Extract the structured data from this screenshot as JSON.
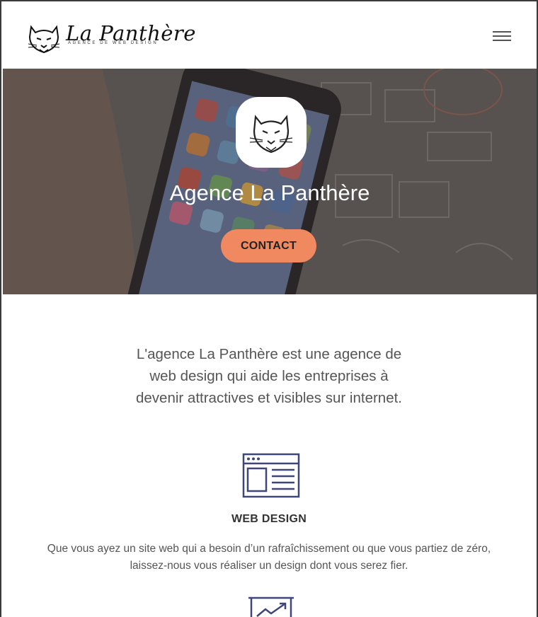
{
  "header": {
    "logo_title": "La Panthère",
    "logo_subtitle": "AGENCE DE WEB DESIGN",
    "menu_icon": "hamburger-menu-icon"
  },
  "hero": {
    "title": "Agence La Panthère",
    "contact_label": "CONTACT",
    "badge_icon": "panther-head-icon",
    "accent_color": "#f0895f"
  },
  "intro": {
    "line1": "L'agence La Panthère est une agence de",
    "line2": "web design qui aide les entreprises à",
    "line3": "devenir attractives et visibles sur internet."
  },
  "services": [
    {
      "icon": "web-page-layout-icon",
      "title": "WEB DESIGN",
      "desc_line1": "Que vous ayez un site web qui a besoin d’un rafraîchissement ou que vous partiez de zéro,",
      "desc_line2": "laissez-nous vous réaliser un design dont vous serez fier."
    },
    {
      "icon": "chart-growth-icon"
    }
  ],
  "colors": {
    "icon_navy": "#3f4678",
    "hero_overlay": "#4a4441"
  }
}
